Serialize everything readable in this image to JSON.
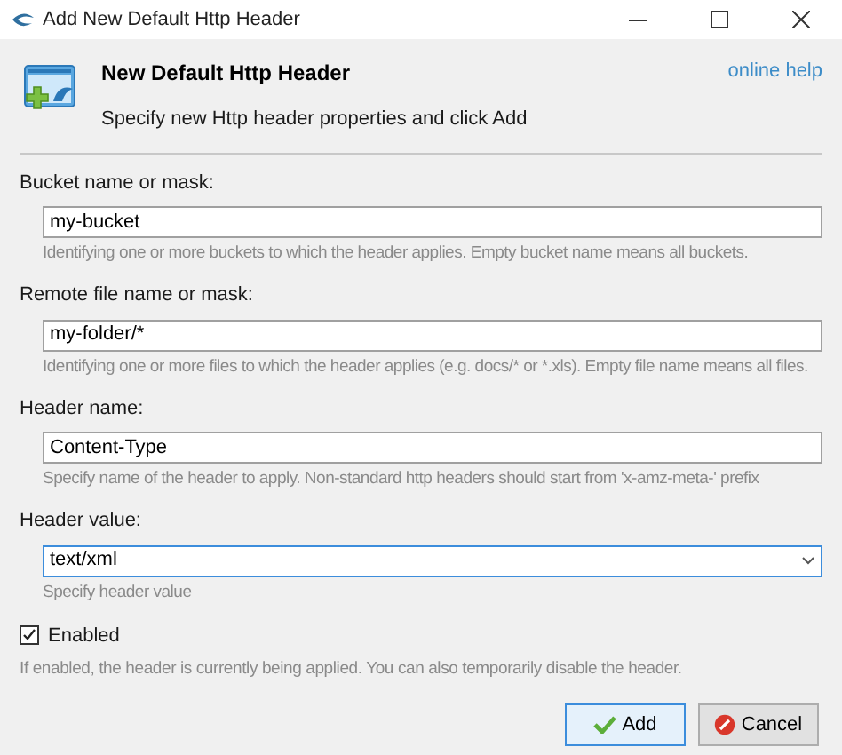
{
  "window": {
    "title": "Add New Default Http Header"
  },
  "header": {
    "title": "New Default Http Header",
    "subtitle": "Specify new Http header properties and click Add",
    "help_link": "online help"
  },
  "fields": [
    {
      "kind": "text",
      "label": "Bucket name or mask:",
      "value": "my-bucket",
      "hint": "Identifying one or more buckets to which the header applies. Empty bucket name means all buckets."
    },
    {
      "kind": "text",
      "label": "Remote file name or mask:",
      "value": "my-folder/*",
      "hint": "Identifying one or more files to which the header applies (e.g. docs/* or *.xls). Empty file name means all files."
    },
    {
      "kind": "text",
      "label": "Header name:",
      "value": "Content-Type",
      "hint": "Specify name of the header to apply. Non-standard http headers should start from 'x-amz-meta-' prefix"
    },
    {
      "kind": "combo",
      "label": "Header value:",
      "value": "text/xml",
      "hint": "Specify header value"
    }
  ],
  "enabled": {
    "label": "Enabled",
    "checked": true,
    "hint": "If enabled, the header is currently being applied. You can also temporarily disable the header."
  },
  "buttons": [
    {
      "kind": "ok",
      "label": "Add",
      "selected": true
    },
    {
      "kind": "cancel",
      "label": "Cancel",
      "selected": false
    }
  ]
}
